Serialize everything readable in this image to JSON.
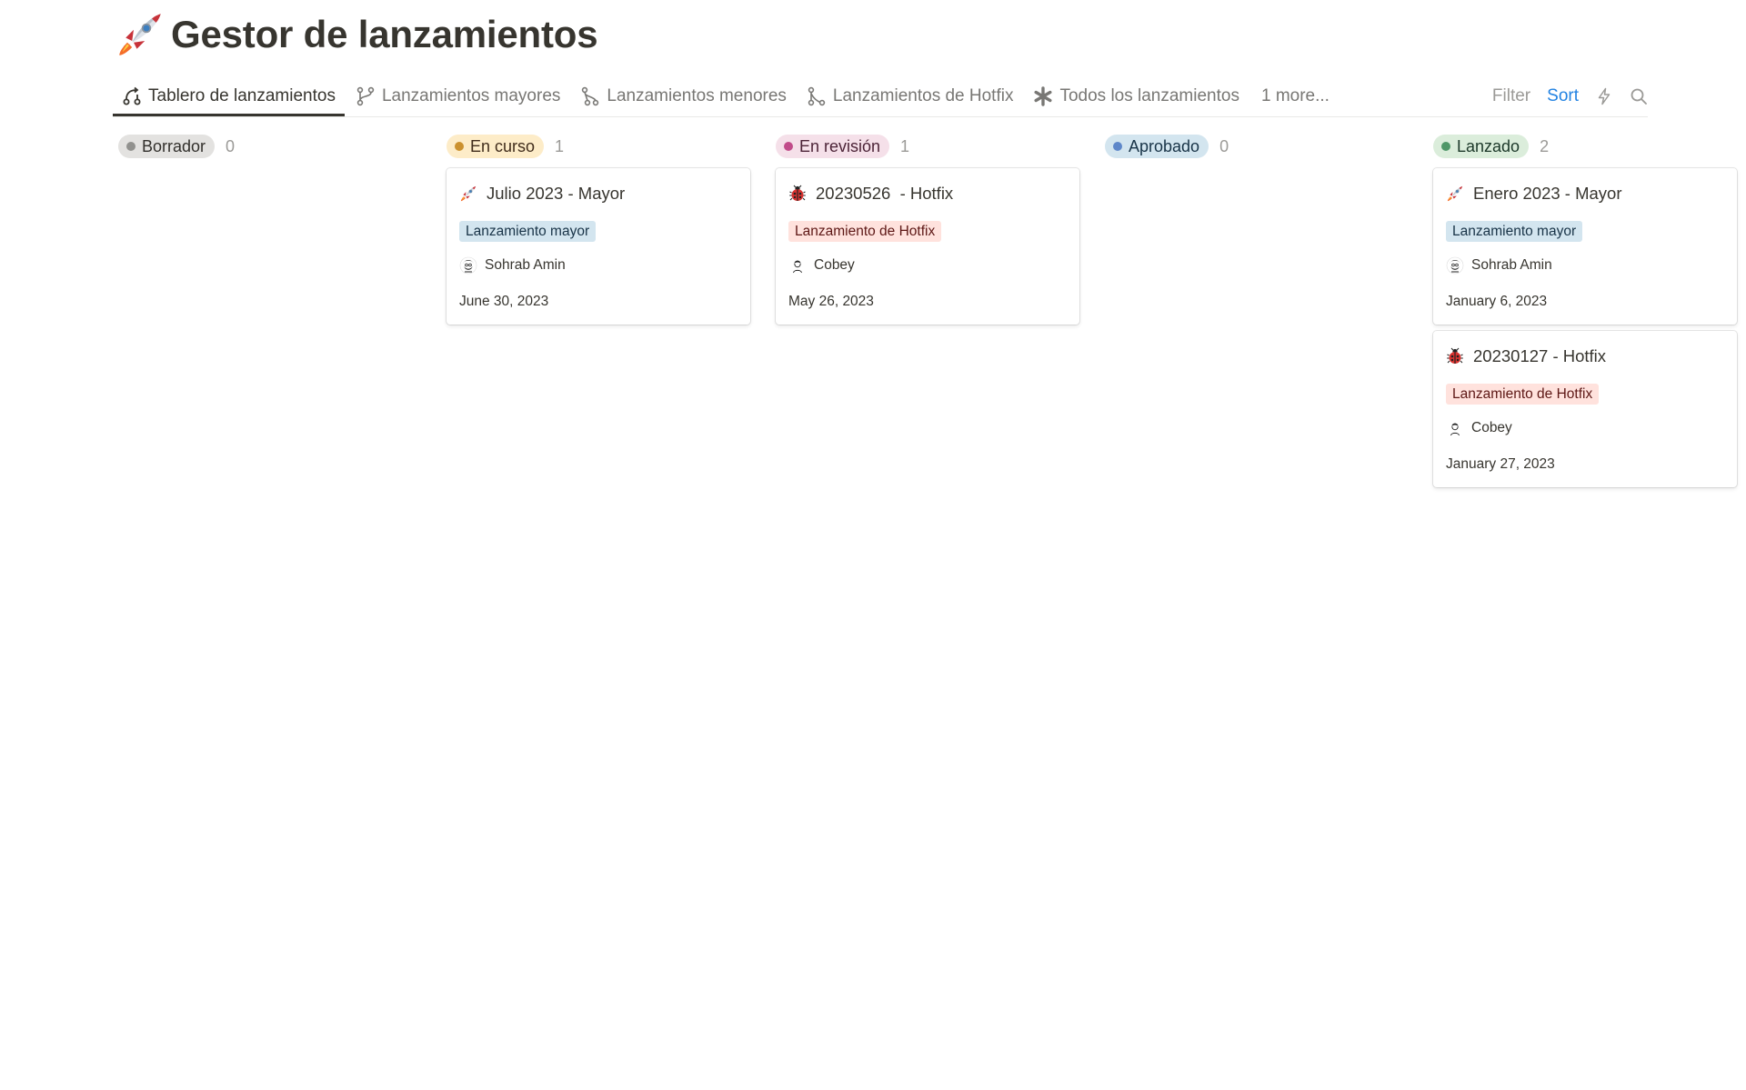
{
  "page": {
    "title": "Gestor de lanzamientos",
    "icon": "rocket-icon"
  },
  "tabs": [
    {
      "label": "Tablero de lanzamientos",
      "icon": "board-flow-icon",
      "active": true
    },
    {
      "label": "Lanzamientos mayores",
      "icon": "branch-icon",
      "active": false
    },
    {
      "label": "Lanzamientos menores",
      "icon": "branch-small-icon",
      "active": false
    },
    {
      "label": "Lanzamientos de Hotfix",
      "icon": "merge-icon",
      "active": false
    },
    {
      "label": "Todos los lanzamientos",
      "icon": "asterisk-icon",
      "active": false
    }
  ],
  "tabs_more": "1 more...",
  "toolbar": {
    "filter": "Filter",
    "sort": "Sort",
    "automation_icon": "lightning-icon",
    "search_icon": "search-icon"
  },
  "colors": {
    "accent": "#2383e2",
    "borrador": "#e3e2e0",
    "en_curso": "#fdecc8",
    "en_revision": "#f5e0e9",
    "aprobado": "#d3e5ef",
    "lanzado": "#dbeddb"
  },
  "columns": [
    {
      "label": "Borrador",
      "count": "0",
      "pill_bg": "#e3e2e0",
      "dot": "#91918e",
      "text": "#32302c",
      "cards": []
    },
    {
      "label": "En curso",
      "count": "1",
      "pill_bg": "#fdecc8",
      "dot": "#cb912f",
      "text": "#402c1b",
      "cards": [
        {
          "title": "Julio 2023 - Mayor",
          "icon": "rocket-icon",
          "tag": "Lanzamiento mayor",
          "tag_type": "major",
          "person": "Sohrab Amin",
          "avatar": "avatar-sohrab-icon",
          "date": "June 30, 2023"
        }
      ]
    },
    {
      "label": "En revisión",
      "count": "1",
      "pill_bg": "#f5e0e9",
      "dot": "#c14c8a",
      "text": "#4c2337",
      "cards": [
        {
          "title": "20230526  - Hotfix",
          "icon": "ladybug-icon",
          "tag": "Lanzamiento de Hotfix",
          "tag_type": "hotfix",
          "person": "Cobey",
          "avatar": "avatar-cobey-icon",
          "date": "May 26, 2023"
        }
      ]
    },
    {
      "label": "Aprobado",
      "count": "0",
      "pill_bg": "#d3e5ef",
      "dot": "#5e87c9",
      "text": "#183347",
      "cards": []
    },
    {
      "label": "Lanzado",
      "count": "2",
      "pill_bg": "#dbeddb",
      "dot": "#4f9768",
      "text": "#1c3829",
      "cards": [
        {
          "title": "Enero 2023 - Mayor",
          "icon": "rocket-icon",
          "tag": "Lanzamiento mayor",
          "tag_type": "major",
          "person": "Sohrab Amin",
          "avatar": "avatar-sohrab-icon",
          "date": "January 6, 2023"
        },
        {
          "title": "20230127 - Hotfix",
          "icon": "ladybug-icon",
          "tag": "Lanzamiento de Hotfix",
          "tag_type": "hotfix",
          "person": "Cobey",
          "avatar": "avatar-cobey-icon",
          "date": "January 27, 2023"
        }
      ]
    }
  ]
}
